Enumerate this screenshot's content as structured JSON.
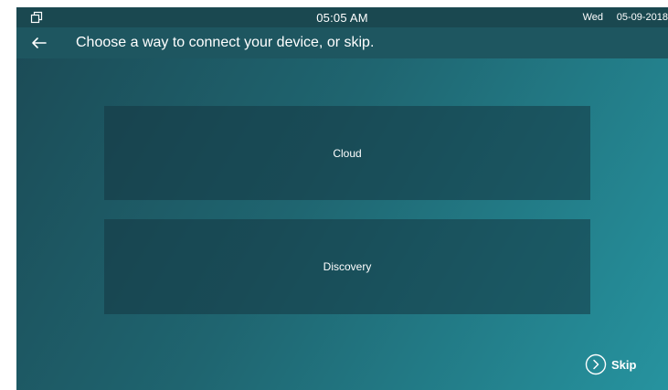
{
  "status_bar": {
    "time": "05:05 AM",
    "day": "Wed",
    "date": "05-09-2018"
  },
  "header": {
    "title": "Choose a way to connect your device, or skip."
  },
  "options": {
    "cloud_label": "Cloud",
    "discovery_label": "Discovery"
  },
  "footer": {
    "skip_label": "Skip"
  },
  "colors": {
    "status_bar": "#1a4850",
    "title_bar": "#1e5660",
    "background_start": "#1b4a55",
    "background_end": "#26939f",
    "text": "#ffffff"
  },
  "icons": {
    "status": "window-restore-icon",
    "back": "arrow-left-icon",
    "skip": "chevron-right-circle-icon"
  }
}
